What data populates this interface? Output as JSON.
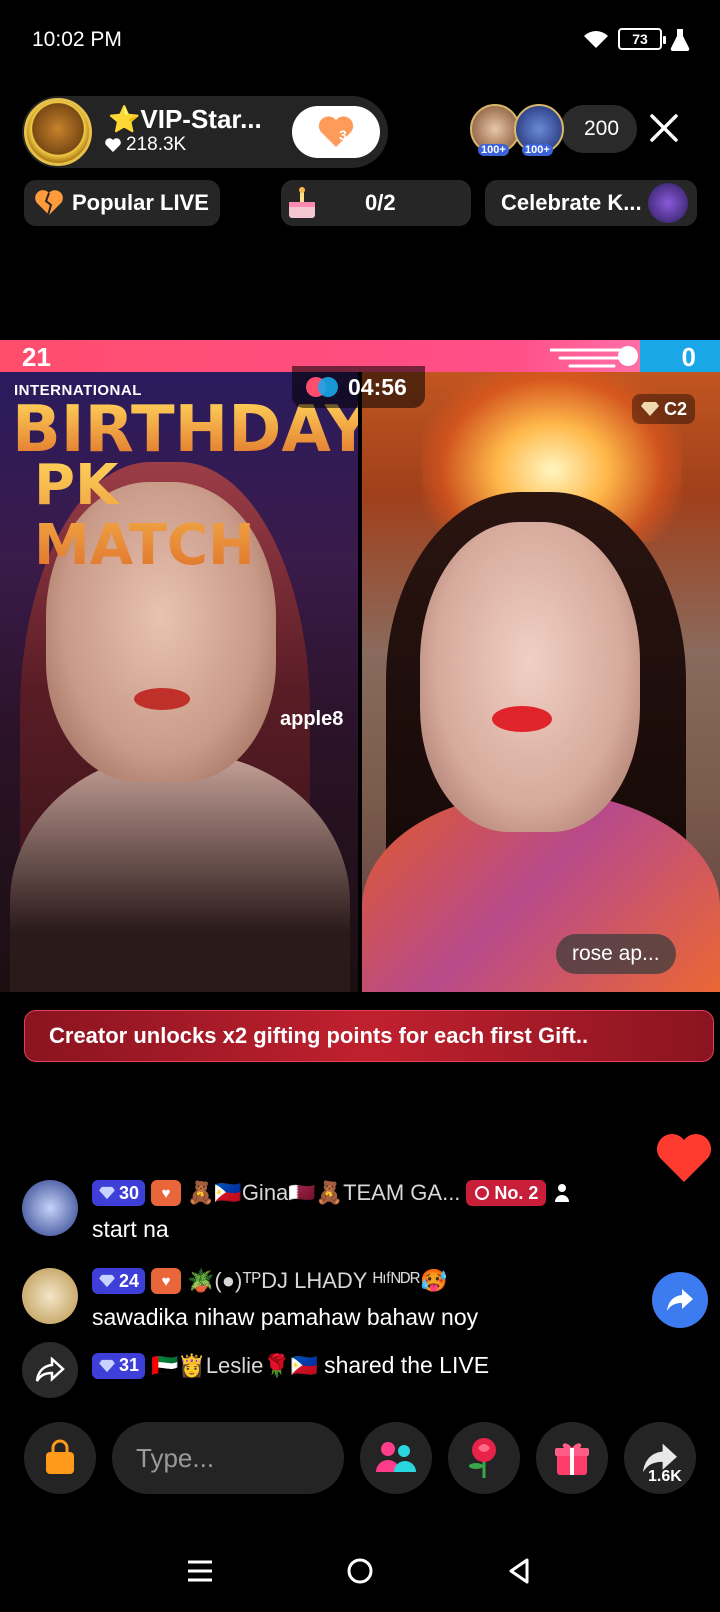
{
  "status_bar": {
    "time": "10:02 PM",
    "battery": "73"
  },
  "host": {
    "name": "⭐VIP-Star...",
    "likes": "218.3K",
    "follow_count": "3"
  },
  "viewers": {
    "badge1": "100+",
    "badge2": "100+",
    "count": "200"
  },
  "pills": {
    "popular": "Popular LIVE",
    "gift_progress": "0/2",
    "celebrate": "Celebrate K..."
  },
  "pk": {
    "left_score": "21",
    "right_score": "0",
    "timer": "04:56",
    "rank_badge": "C2",
    "opponent_name": "rose ap..."
  },
  "video_left": {
    "overlay_small": "INTERNATIONAL",
    "overlay_big": "BIRTHDAY",
    "overlay_pk": "PK MATCH",
    "overlay_name": "apple8"
  },
  "banner": {
    "text": "Creator unlocks x2 gifting points for each first Gift.."
  },
  "chat": [
    {
      "level": "30",
      "user": "🧸🇵🇭Gina🇶🇦🧸TEAM GA...",
      "rank": "No. 2",
      "message": "start na"
    },
    {
      "level": "24",
      "user": "🪴(●)ᵀᴾDJ LHADY ᴴᶦᶠᴺᴰᴿ🥵",
      "message": "sawadika nihaw pamahaw bahaw noy"
    },
    {
      "level": "31",
      "user": "🇦🇪👸Leslie🌹🇵🇭",
      "message": "shared the LIVE"
    }
  ],
  "input": {
    "placeholder": "Type..."
  },
  "share": {
    "count": "1.6K"
  },
  "colors": {
    "pk_red": "#ff4d6d",
    "pk_blue": "#1aa7e8",
    "level_badge": "#3d3fd8",
    "share_blue": "#3c7cf0"
  }
}
